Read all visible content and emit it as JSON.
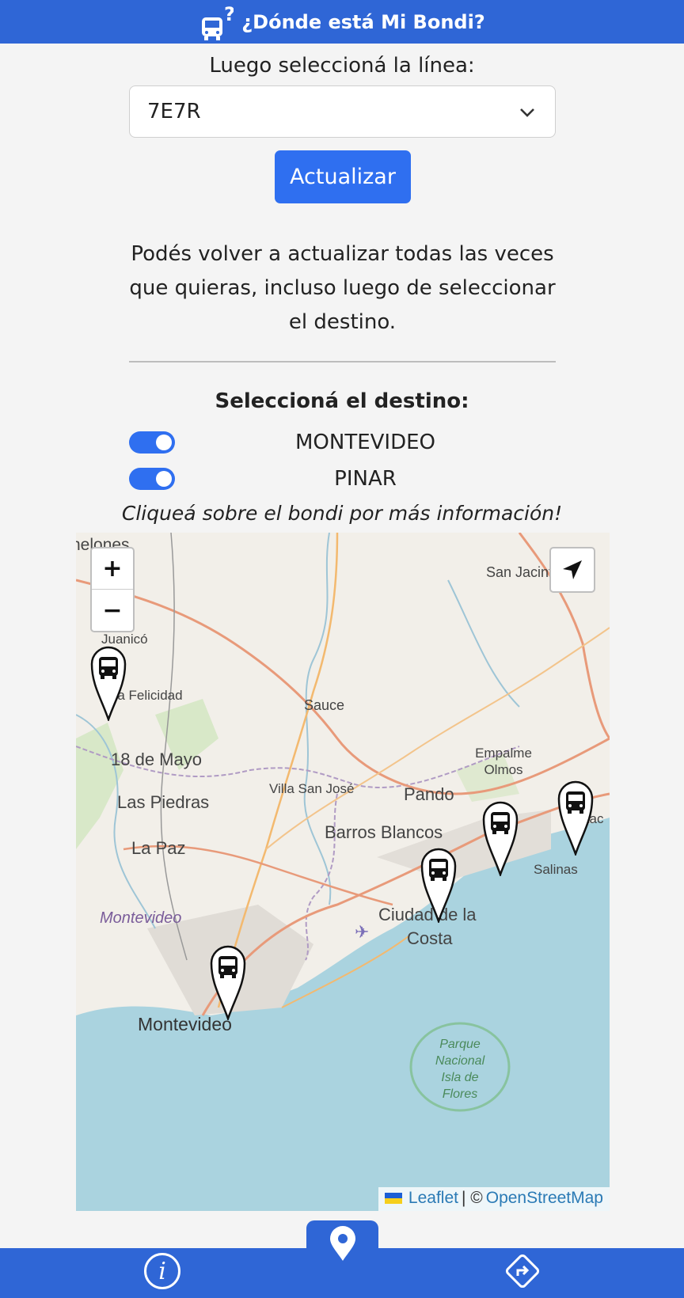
{
  "header": {
    "title": "¿Dónde está Mi Bondi?",
    "icon": "bus-question-icon"
  },
  "line_selector": {
    "label": "Luego seleccioná la línea:",
    "selected": "7E7R"
  },
  "update_button": {
    "label": "Actualizar"
  },
  "note": {
    "text": "Podés volver a actualizar todas las veces que quieras, incluso luego de seleccionar el destino."
  },
  "destinations": {
    "label": "Seleccioná el destino:",
    "items": [
      {
        "name": "MONTEVIDEO",
        "enabled": true
      },
      {
        "name": "PINAR",
        "enabled": true
      }
    ]
  },
  "hint": {
    "text": "Cliqueá sobre el bondi por más información!"
  },
  "map": {
    "zoom_in": "+",
    "zoom_out": "−",
    "places": [
      "nelones",
      "San Jacint",
      "Juanicó",
      "Villa Felicidad",
      "Sauce",
      "18 de Mayo",
      "Empalme Olmos",
      "Las Piedras",
      "Villa San José",
      "Pando",
      "Estac",
      "La Paz",
      "Barros Blancos",
      "Salinas",
      "Montevideo",
      "Ciudad de la",
      "Costa",
      "Montevideo",
      "Parque",
      "Nacional",
      "Isla de",
      "Flores"
    ],
    "bus_markers": 5,
    "attribution": {
      "leaflet": "Leaflet",
      "separator": "| ©",
      "osm": "OpenStreetMap"
    }
  },
  "colors": {
    "primary": "#2f66d6",
    "button": "#2f6ff0",
    "water": "#aad3df"
  },
  "nav": {
    "left": "info-icon",
    "center": "map-pin-icon",
    "right": "directions-icon"
  }
}
